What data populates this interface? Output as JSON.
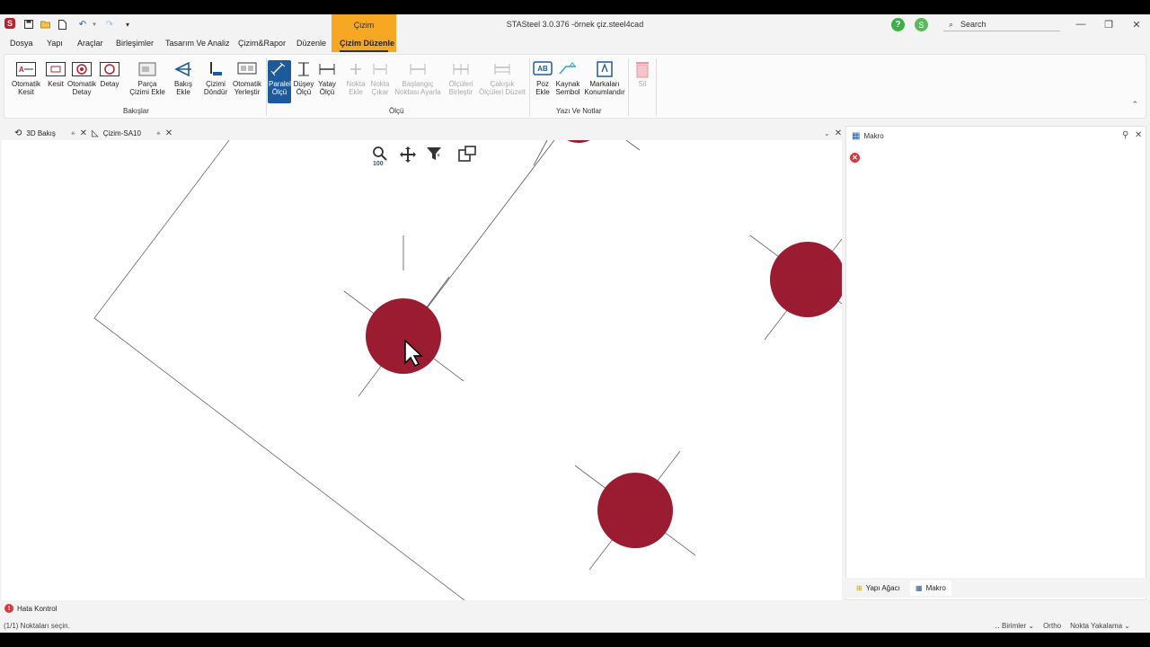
{
  "titlebar": {
    "app_logo": "S",
    "context_tab": "Çizim",
    "title": "STASteel 3.0.376 -örnek çiz.steel4cad",
    "help": "?",
    "user": "S",
    "search_placeholder": "Search",
    "controls": [
      "—",
      "❐",
      "✕"
    ]
  },
  "menu": {
    "items": [
      "Dosya",
      "Yapı",
      "Araçlar",
      "Birleşimler",
      "Tasarım Ve Analiz",
      "Çizim&Rapor",
      "Düzenle",
      "Çizim Düzenle"
    ]
  },
  "ribbon": {
    "bakislar": {
      "label": "Bakışlar",
      "buttons": [
        "Otomatik Kesit",
        "Kesit",
        "Otomatik Detay",
        "Detay",
        "Parça Çizimi Ekle",
        "Bakış Ekle",
        "Çizimi Döndür",
        "Otomatik Yerleştir"
      ]
    },
    "olcu": {
      "label": "Ölçü",
      "buttons": [
        "Paralel Ölçü",
        "Düşey Ölçü",
        "Yatay Ölçü",
        "Nokta Ekle",
        "Nokta Çıkar",
        "Başlangıç Noktası Ayarla",
        "Ölçüleri Birleştir",
        "Çakışık Ölçüleri Düzelt"
      ]
    },
    "yazi": {
      "label": "Yazı Ve Notlar",
      "buttons": [
        "Poz Ekle",
        "Kaynak Sembol",
        "Markaları Konumlandır"
      ]
    },
    "sil": "Sil",
    "poz_icon_text": "AB"
  },
  "doc_tabs": [
    "3D Bakış",
    "Çizim-SA10"
  ],
  "canvas": {
    "zoom_level": "100"
  },
  "panel": {
    "title": "Makro",
    "bottom_tabs": [
      "Yapı Ağacı",
      "Makro"
    ]
  },
  "status": {
    "hata_kontrol": "Hata Kontrol",
    "message": "(1/1) Noktaları seçin.",
    "right": [
      "Birimler",
      "Ortho",
      "Nokta Yakalama"
    ]
  },
  "colors": {
    "accent": "#1d5a9c",
    "context_tab": "#f7a823",
    "bolt": "#9b1b30"
  }
}
